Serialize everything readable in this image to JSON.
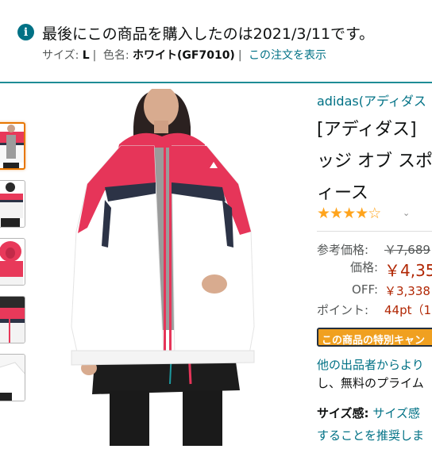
{
  "notice": {
    "message": "最後にこの商品を購入したのは2021/3/11です。",
    "size_label": "サイズ:",
    "size_value": "L",
    "color_label": "色名:",
    "color_value": "ホワイト(GF7010)",
    "view_order_link": "この注文を表示",
    "accent_color": "#007185"
  },
  "product": {
    "brand": "adidas(アディダス",
    "title_lines": [
      "[アディダス]",
      "ッジ オブ スポ",
      "ィース"
    ],
    "rating_stars": 4,
    "rating_max": 5,
    "rating_color": "#ffa41c"
  },
  "pricing": {
    "list_price_label": "参考価格:",
    "list_price": "￥7,689",
    "price_label": "価格:",
    "price": "￥4,35",
    "off_label": "OFF:",
    "off_value": "￥3,338",
    "points_label": "ポイント:",
    "points_value": "44pt（1",
    "price_color": "#b12704"
  },
  "campaign": {
    "badge_text": "この商品の特別キャン"
  },
  "sellers": {
    "line1": "他の出品者からより",
    "line2": "し、無料のプライム"
  },
  "size_info": {
    "label": "サイズ感:",
    "link": "サイズ感",
    "recommend": "することを推奨しま"
  },
  "icons": {
    "info": "info-icon",
    "chevron": "chevron-down-icon",
    "star": "star-icon"
  }
}
